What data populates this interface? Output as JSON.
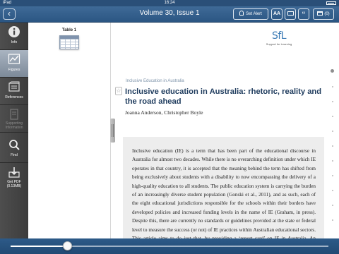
{
  "statusbar": {
    "device": "iPad",
    "time": "16:24"
  },
  "navbar": {
    "back_label": "‹",
    "title": "Volume 30, Issue 1",
    "set_alert": "Set Alert",
    "font_size": "AA",
    "cite": "‘‘",
    "downloads": "(0)"
  },
  "sidebar": {
    "items": [
      {
        "label": "Info",
        "icon": "info-icon"
      },
      {
        "label": "Figures",
        "icon": "chart-icon"
      },
      {
        "label": "References",
        "icon": "references-icon"
      },
      {
        "label": "Supporting Information",
        "icon": "attachment-icon"
      },
      {
        "label": "Find",
        "icon": "search-icon"
      },
      {
        "label": "Get PDF (0.13MB)",
        "icon": "download-icon"
      }
    ]
  },
  "figures": {
    "items": [
      {
        "label": "Table 1"
      }
    ]
  },
  "article": {
    "logo_text": "SfL",
    "logo_tagline": "Support for Learning",
    "section": "Inclusive Education in Australia",
    "title": "Inclusive education in Australia: rhetoric, reality and the road ahead",
    "authors": "Joanna Anderson, Christopher Boyle",
    "abstract": "Inclusive education (IE) is a term that has been part of the educational discourse in Australia for almost two decades. While there is no overarching definition under which IE operates in that country, it is accepted that the meaning behind the term has shifted from being exclusively about students with a disability to now encompassing the delivery of a high-quality education to all students. The public education system is carrying the burden of an increasingly diverse student population (Gonski et al., 2011), and as such, each of the eight educational jurisdictions responsible for the schools within their borders have developed policies and increased funding levels in the name of IE (Graham, in press). Despite this, there are currently no standards or guidelines provided at the state or federal level to measure the success (or not) of IE practices within Australian educational sectors. This article aims to do just that, by providing a ‘report card’ on IE in Australia. An extensive review of the current literature and related educational policies and reports was con-"
  },
  "page_slider": {
    "position": 0.18
  },
  "colors": {
    "nav": "#2b5683",
    "accent": "#3a7ab5",
    "title": "#1f3c5e"
  }
}
